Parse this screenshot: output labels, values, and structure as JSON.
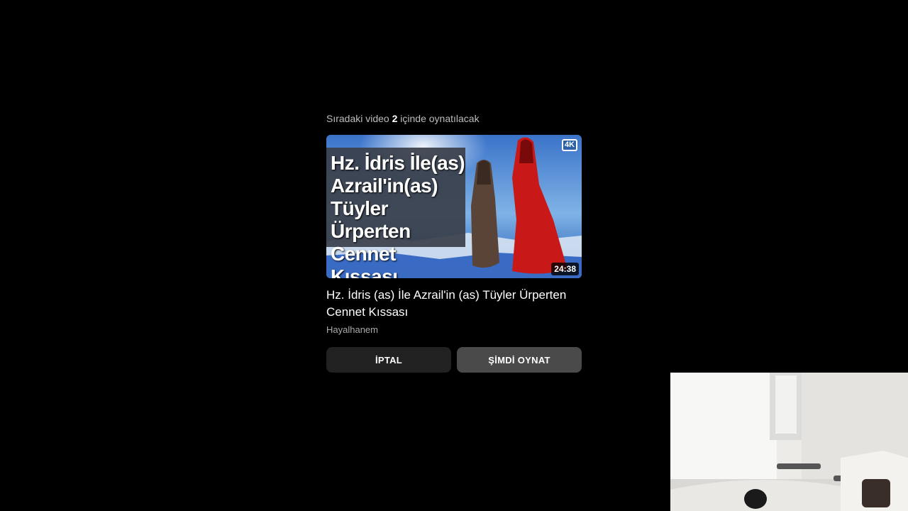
{
  "upnext": {
    "prefix": "Sıradaki video",
    "count": "2",
    "suffix": "içinde oynatılacak"
  },
  "video": {
    "thumbnail_caption": "Hz. İdris İle(as) Azrail'in(as) Tüyler Ürperten Cennet Kıssası",
    "badge": "4K",
    "duration": "24:38",
    "title": "Hz. İdris (as) İle Azrail'in (as) Tüyler Ürperten Cennet Kıssası",
    "channel": "Hayalhanem"
  },
  "buttons": {
    "cancel": "İPTAL",
    "play_now": "ŞİMDİ OYNAT"
  },
  "colors": {
    "background": "#000000",
    "cancel_button": "#212121",
    "play_button": "#4a4a4a",
    "secondary_text": "#aaaaaa"
  },
  "icons": [
    "badge-4k-icon"
  ]
}
